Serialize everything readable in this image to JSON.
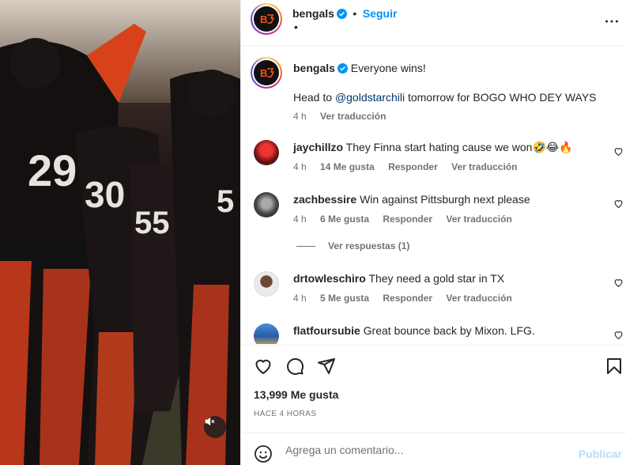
{
  "colors": {
    "accent": "#0095f6",
    "brand_orange": "#fb4f14",
    "muted": "#737373",
    "publish_disabled": "#b2dffc"
  },
  "media": {
    "jersey_numbers": [
      "29",
      "30",
      "55",
      "5"
    ],
    "mute_icon": "speaker-muted-icon"
  },
  "header": {
    "username": "bengals",
    "follow_label": "Seguir",
    "subline": "•",
    "more_icon": "ellipsis-icon"
  },
  "caption": {
    "username": "bengals",
    "text": "Everyone wins!",
    "line2_prefix": "Head to ",
    "mention": "@goldstarchili",
    "line2_suffix": " tomorrow for BOGO WHO DEY WAYS",
    "time": "4 h",
    "translate": "Ver traducción"
  },
  "comments": [
    {
      "username": "jaychillzo",
      "text": "They Finna start hating cause we won🤣😂🔥",
      "time": "4 h",
      "likes": "14 Me gusta",
      "reply": "Responder",
      "translate": "Ver traducción"
    },
    {
      "username": "zachbessire",
      "text": "Win against Pittsburgh next please",
      "time": "4 h",
      "likes": "6 Me gusta",
      "reply": "Responder",
      "translate": "Ver traducción",
      "replies_label": "Ver respuestas (1)"
    },
    {
      "username": "drtowleschiro",
      "text": "They need a gold star in TX",
      "time": "4 h",
      "likes": "5 Me gusta",
      "reply": "Responder",
      "translate": "Ver traducción"
    },
    {
      "username": "flatfoursubie",
      "text": "Great bounce back by Mixon. LFG."
    }
  ],
  "actions": {
    "likes": "13,999 Me gusta",
    "time_ago": "HACE 4 HORAS",
    "icons": [
      "heart-icon",
      "comment-icon",
      "share-icon",
      "bookmark-icon"
    ]
  },
  "add_comment": {
    "placeholder": "Agrega un comentario...",
    "publish_label": "Publicar",
    "emoji_icon": "smiley-icon"
  }
}
